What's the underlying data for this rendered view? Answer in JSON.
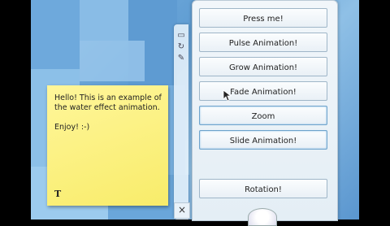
{
  "note": {
    "text": "Hello! This is an example of the water effect animation.\n\nEnjoy! :-)",
    "footer": "T"
  },
  "toolbar_icons": [
    "window-icon",
    "refresh-icon",
    "wrench-icon"
  ],
  "close_glyph": "×",
  "buttons": [
    {
      "label": "Press me!"
    },
    {
      "label": "Pulse Animation!"
    },
    {
      "label": "Grow Animation!"
    },
    {
      "label": "Fade Animation!"
    },
    {
      "label": "Zoom"
    },
    {
      "label": "Slide Animation!"
    },
    {
      "label": "Rotation!"
    }
  ]
}
